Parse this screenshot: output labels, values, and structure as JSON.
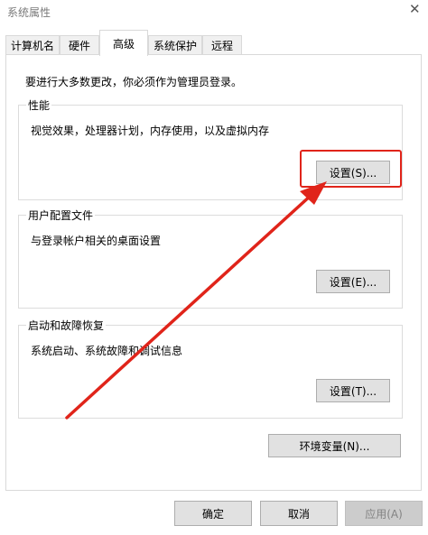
{
  "window": {
    "title": "系统属性"
  },
  "tabs": [
    {
      "label": "计算机名"
    },
    {
      "label": "硬件"
    },
    {
      "label": "高级"
    },
    {
      "label": "系统保护"
    },
    {
      "label": "远程"
    }
  ],
  "admin_notice": "要进行大多数更改，你必须作为管理员登录。",
  "performance": {
    "title": "性能",
    "description": "视觉效果，处理器计划，内存使用，以及虚拟内存",
    "button": "设置(S)..."
  },
  "user_profiles": {
    "title": "用户配置文件",
    "description": "与登录帐户相关的桌面设置",
    "button": "设置(E)..."
  },
  "startup_recovery": {
    "title": "启动和故障恢复",
    "description": "系统启动、系统故障和调试信息",
    "button": "设置(T)..."
  },
  "env_button": "环境变量(N)...",
  "footer": {
    "ok": "确定",
    "cancel": "取消",
    "apply": "应用(A)"
  },
  "annotation_color": "#e0241a"
}
